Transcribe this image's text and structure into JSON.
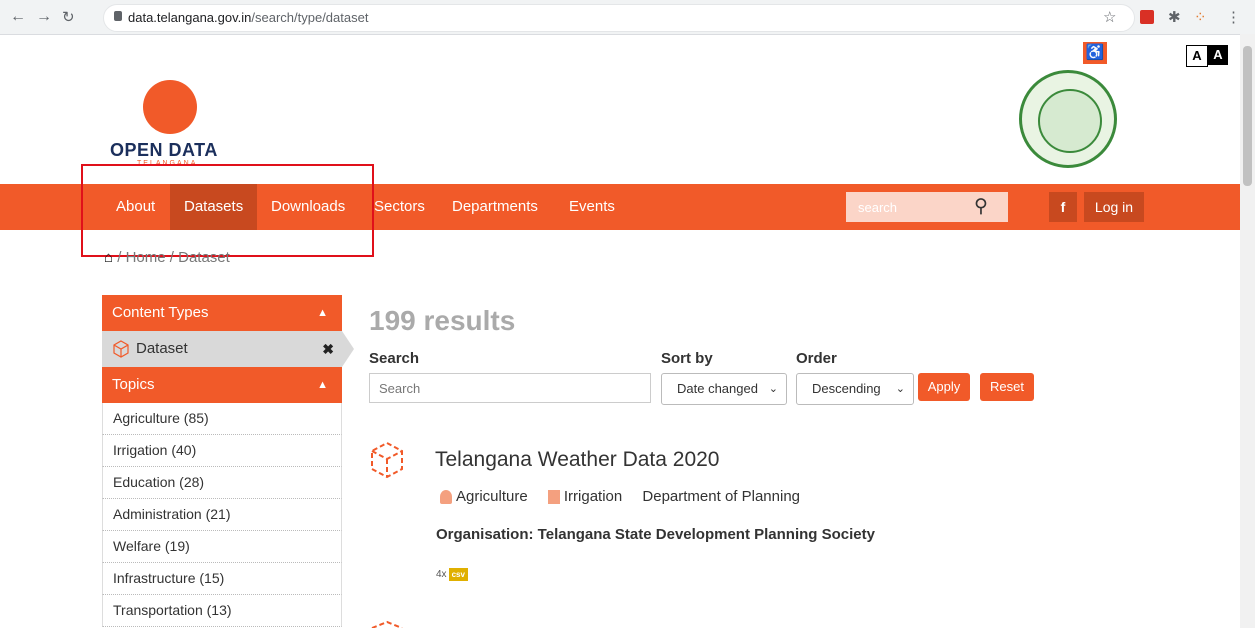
{
  "browser": {
    "url_host": "data.telangana.gov.in",
    "url_path": "/search/type/dataset"
  },
  "header": {
    "logo_title": "OPEN DATA",
    "logo_subtitle": "TELANGANA",
    "font_small": "A",
    "font_large": "A"
  },
  "nav": {
    "items": [
      "About",
      "Datasets",
      "Downloads",
      "Sectors",
      "Departments",
      "Events"
    ],
    "active": "Datasets",
    "search_placeholder": "search",
    "facebook": "f",
    "login": "Log in"
  },
  "breadcrumb": {
    "home": "Home",
    "sep": "/",
    "current": "Dataset"
  },
  "sidebar": {
    "content_types_label": "Content Types",
    "selected_type": "Dataset",
    "topics_label": "Topics",
    "topics": [
      "Agriculture (85)",
      "Irrigation (40)",
      "Education (28)",
      "Administration (21)",
      "Welfare (19)",
      "Infrastructure (15)",
      "Transportation (13)"
    ]
  },
  "search": {
    "results_count": "199 results",
    "search_label": "Search",
    "search_placeholder": "Search",
    "sort_label": "Sort by",
    "sort_value": "Date changed",
    "order_label": "Order",
    "order_value": "Descending",
    "apply": "Apply",
    "reset": "Reset"
  },
  "dataset": {
    "title": "Telangana Weather Data 2020",
    "tag1": "Agriculture",
    "tag2": "Irrigation",
    "department": "Department of Planning",
    "organisation": "Organisation: Telangana State Development Planning Society",
    "format_count": "4x",
    "format": "csv"
  },
  "colors": {
    "brand_orange": "#f15a29",
    "active_nav": "#c8491f",
    "highlight_box": "#e0101a"
  }
}
